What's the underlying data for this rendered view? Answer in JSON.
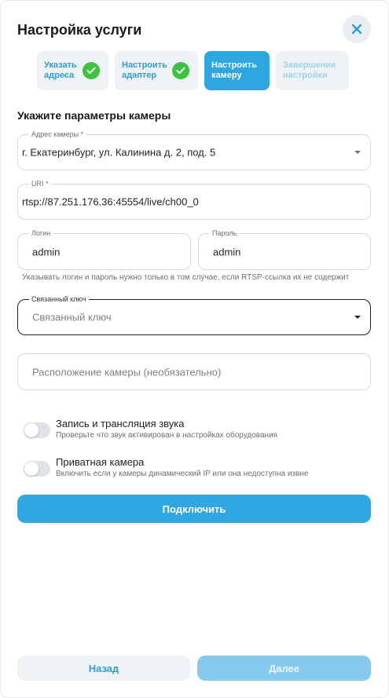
{
  "header": {
    "title": "Настройка услуги"
  },
  "steps": [
    {
      "label": "Указать адреса",
      "state": "done"
    },
    {
      "label": "Настроить адаптер",
      "state": "done"
    },
    {
      "label": "Настроить камеру",
      "state": "active"
    },
    {
      "label": "Завершение настройки",
      "state": "todo"
    }
  ],
  "section": {
    "title": "Укажите параметры камеры"
  },
  "form": {
    "address": {
      "label": "Адрес камеры *",
      "value": "г. Екатеринбург, ул. Калинина д. 2, под. 5"
    },
    "uri": {
      "label": "URI *",
      "value": "rtsp://87.251.176.36:45554/live/ch00_0"
    },
    "login": {
      "label": "Логин",
      "value": "admin"
    },
    "password": {
      "label": "Пароль",
      "value": "admin"
    },
    "login_hint": "Указывать логин и пароль нужно только в том случае, если RTSP-ссылка их не содержит",
    "linked_key": {
      "label": "Связанный ключ",
      "placeholder": "Связанный ключ"
    },
    "location": {
      "placeholder": "Расположение камеры (необязательно)"
    }
  },
  "toggles": {
    "audio": {
      "title": "Запись и трансляция звука",
      "subtitle": "Проверьте что звук активирован в настройках оборудования",
      "on": false
    },
    "private": {
      "title": "Приватная камера",
      "subtitle": "Включить если у камеры динамический IP или она недоступна извне",
      "on": false
    }
  },
  "buttons": {
    "connect": "Подключить",
    "back": "Назад",
    "next": "Далее"
  },
  "colors": {
    "accent": "#30a6e3",
    "success": "#3cc43f",
    "disabled_accent": "#86cbee"
  },
  "icons": {
    "close": "close-icon",
    "check": "check-icon",
    "dropdown": "chevron-down-icon"
  }
}
